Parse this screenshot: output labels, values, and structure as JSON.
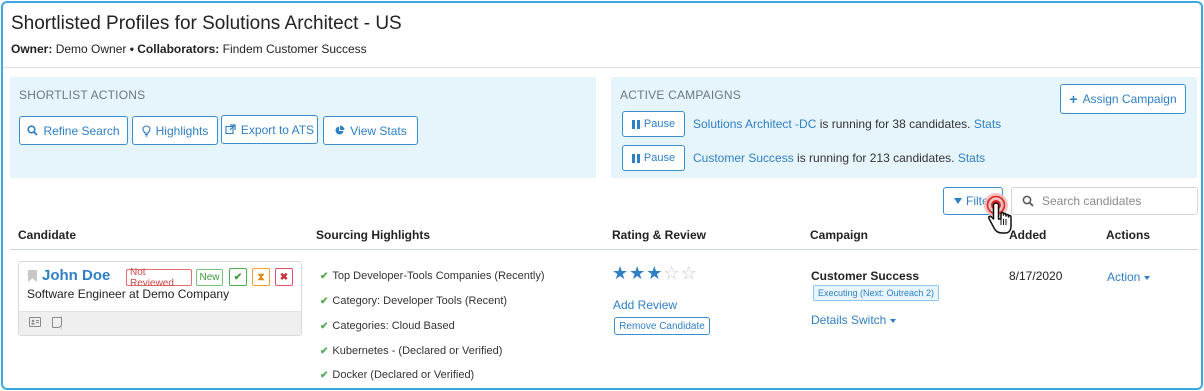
{
  "header": {
    "title": "Shortlisted Profiles for Solutions Architect - US",
    "owner_label": "Owner:",
    "owner_value": "Demo Owner",
    "bullet": "•",
    "collaborators_label": "Collaborators:",
    "collaborators_value": "Findem Customer Success"
  },
  "shortlist_actions": {
    "title": "SHORTLIST ACTIONS",
    "buttons": [
      {
        "label": "Refine Search",
        "icon": "search-icon"
      },
      {
        "label": "Highlights",
        "icon": "lightbulb-icon"
      },
      {
        "label": "Export to ATS",
        "icon": "external-link-icon"
      },
      {
        "label": "View Stats",
        "icon": "pie-chart-icon"
      }
    ]
  },
  "active_campaigns": {
    "title": "ACTIVE CAMPAIGNS",
    "assign_label": "Assign Campaign",
    "pause_label": "Pause",
    "campaigns": [
      {
        "name": "Solutions Architect -DC",
        "text": " is running for 38 candidates. ",
        "stats_label": "Stats"
      },
      {
        "name": "Customer Success",
        "text": " is running for 213 candidates. ",
        "stats_label": "Stats"
      }
    ]
  },
  "toolbar": {
    "filter_label": "Filter",
    "search_placeholder": "Search candidates"
  },
  "table": {
    "columns": [
      "Candidate",
      "Sourcing Highlights",
      "Rating & Review",
      "Campaign",
      "Added",
      "Actions"
    ],
    "rows": [
      {
        "name": "John Doe",
        "title": "Software Engineer at Demo Company",
        "status_tag": "Not Reviewed",
        "new_tag": "New",
        "highlights": [
          "Top Developer-Tools Companies (Recently)",
          "Category: Developer Tools (Recent)",
          "Categories: Cloud Based",
          "Kubernetes - (Declared or Verified)",
          "Docker (Declared or Verified)"
        ],
        "rating": 3,
        "rating_max": 5,
        "add_review_label": "Add Review",
        "remove_label": "Remove Candidate",
        "campaign_name": "Customer Success",
        "campaign_status": "Executing (Next: Outreach 2)",
        "details_label": "Details Switch",
        "added": "8/17/2020",
        "action_label": "Action"
      }
    ]
  },
  "colors": {
    "accent": "#2f7fc4",
    "panel_bg": "#e6f4fc",
    "frame": "#3da9dc"
  }
}
